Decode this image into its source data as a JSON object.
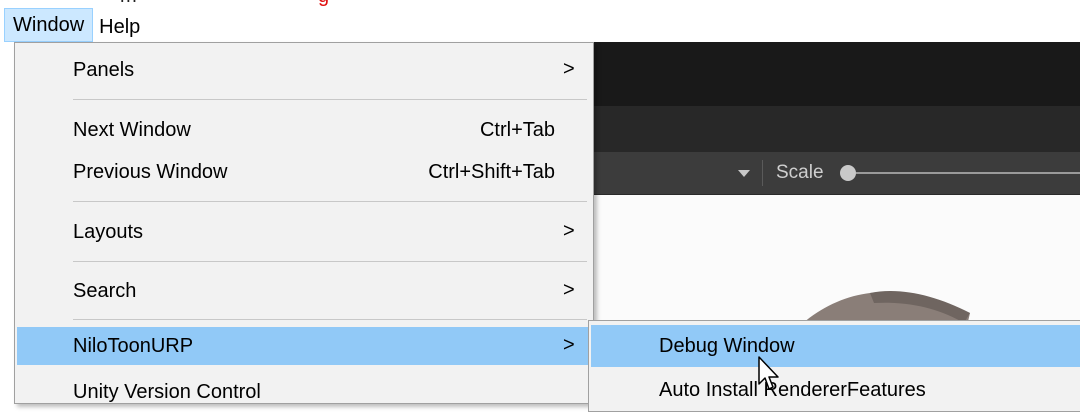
{
  "top_annotation": {
    "red_text": "g",
    "black_text": "m"
  },
  "menubar": {
    "items": [
      {
        "label": "Window"
      },
      {
        "label": "Help"
      }
    ]
  },
  "window_menu": {
    "items": [
      {
        "label": "Panels",
        "shortcut": "",
        "submenu_arrow": ">"
      },
      {
        "label": "Next Window",
        "shortcut": "Ctrl+Tab",
        "submenu_arrow": ""
      },
      {
        "label": "Previous Window",
        "shortcut": "Ctrl+Shift+Tab",
        "submenu_arrow": ""
      },
      {
        "label": "Layouts",
        "shortcut": "",
        "submenu_arrow": ">"
      },
      {
        "label": "Search",
        "shortcut": "",
        "submenu_arrow": ">"
      },
      {
        "label": "NiloToonURP",
        "shortcut": "",
        "submenu_arrow": ">",
        "highlighted": true
      },
      {
        "label": "Unity Version Control",
        "shortcut": "",
        "submenu_arrow": ""
      }
    ]
  },
  "nilotoon_submenu": {
    "items": [
      {
        "label": "Debug Window",
        "highlighted": true
      },
      {
        "label": "Auto Install RendererFeatures"
      }
    ]
  },
  "editor_toolbar": {
    "dropdown_icon": "triangle-down-icon",
    "scale_label": "Scale"
  },
  "colors": {
    "highlight": "#91c9f7",
    "menubar_active": "#cce8ff",
    "menu_background": "#f2f2f2",
    "editor_dark": "#191919",
    "toolbar": "#3c3c3c"
  }
}
